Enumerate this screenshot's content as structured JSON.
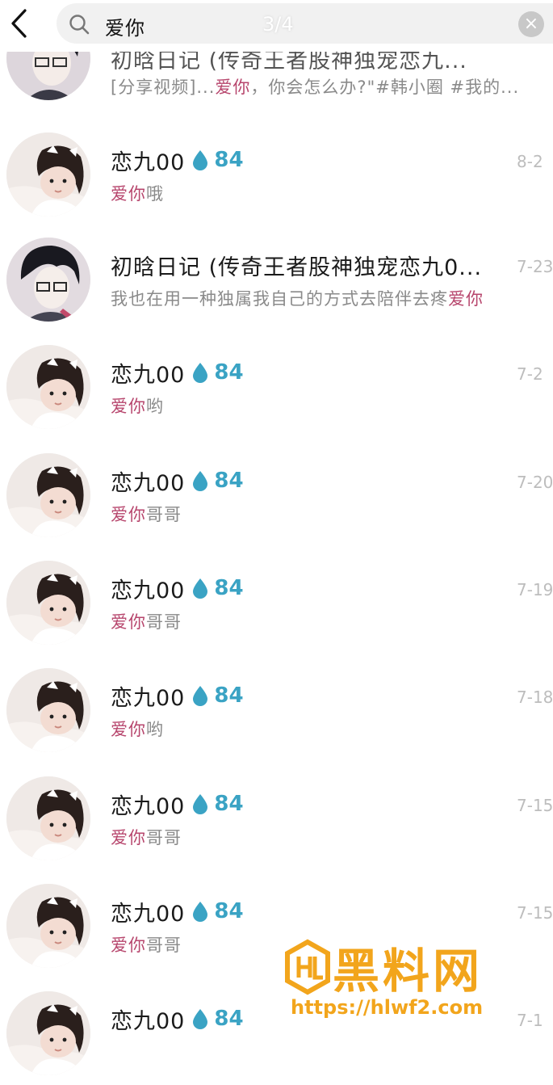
{
  "search": {
    "back_icon": "chevron-left-icon",
    "icon": "search-icon",
    "query": "爱你",
    "counter": "3/4",
    "clear_icon": "close-circle-icon",
    "clear_glyph": "×"
  },
  "badge": {
    "icon": "water-drop-icon",
    "color": "#3aa3c4"
  },
  "highlight_color": "#b7466d",
  "results": [
    {
      "name": "初晗日记 (传奇王者股神独宠恋九...",
      "hit": "",
      "msg": "",
      "preview_prefix": "[分享视频]...",
      "preview_hit": "爱你",
      "preview_suffix": "，你会怎么办?\"#韩小圈 #我的...",
      "time": "",
      "avatar": "boy-glasses"
    },
    {
      "name": "恋九00",
      "level": "84",
      "preview_prefix": "",
      "preview_hit": "爱你",
      "preview_suffix": "哦",
      "time": "8-2",
      "avatar": "girl"
    },
    {
      "name": "初晗日记 (传奇王者股神独宠恋九0...",
      "level": "",
      "preview_prefix": "我也在用一种独属我自己的方式去陪伴去疼",
      "preview_hit": "爱你",
      "preview_suffix": "",
      "time": "7-23",
      "avatar": "boy-glasses"
    },
    {
      "name": "恋九00",
      "level": "84",
      "preview_prefix": "",
      "preview_hit": "爱你",
      "preview_suffix": "哟",
      "time": "7-2",
      "avatar": "girl"
    },
    {
      "name": "恋九00",
      "level": "84",
      "preview_prefix": "",
      "preview_hit": "爱你",
      "preview_suffix": "哥哥",
      "time": "7-20",
      "avatar": "girl"
    },
    {
      "name": "恋九00",
      "level": "84",
      "preview_prefix": "",
      "preview_hit": "爱你",
      "preview_suffix": "哥哥",
      "time": "7-19",
      "avatar": "girl"
    },
    {
      "name": "恋九00",
      "level": "84",
      "preview_prefix": "",
      "preview_hit": "爱你",
      "preview_suffix": "哟",
      "time": "7-18",
      "avatar": "girl"
    },
    {
      "name": "恋九00",
      "level": "84",
      "preview_prefix": "",
      "preview_hit": "爱你",
      "preview_suffix": "哥哥",
      "time": "7-15",
      "avatar": "girl"
    },
    {
      "name": "恋九00",
      "level": "84",
      "preview_prefix": "",
      "preview_hit": "爱你",
      "preview_suffix": "哥哥",
      "time": "7-15",
      "avatar": "girl"
    },
    {
      "name": "恋九00",
      "level": "84",
      "preview_prefix": "",
      "preview_hit": "",
      "preview_suffix": "",
      "time": "7-1",
      "avatar": "girl"
    }
  ],
  "watermark": {
    "title": "黑料网",
    "url": "https://hlwf2.com"
  }
}
